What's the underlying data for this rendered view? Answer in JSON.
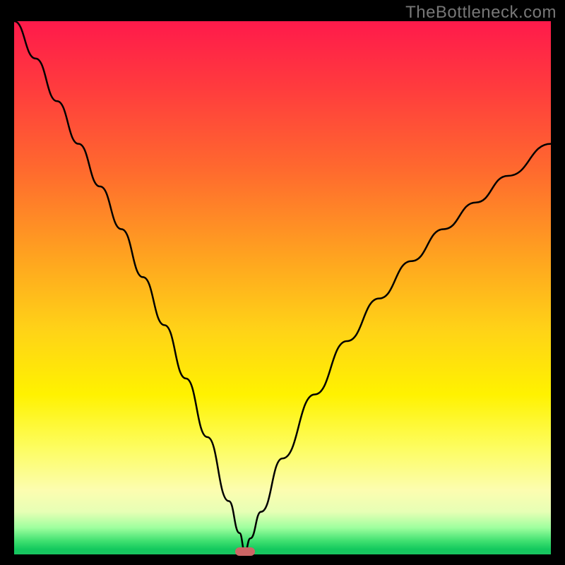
{
  "watermark": "TheBottleneck.com",
  "colors": {
    "gradient_top": "#ff1a4b",
    "gradient_bottom": "#18c560",
    "curve": "#000000",
    "marker": "#cc6666",
    "frame": "#000000"
  },
  "chart_data": {
    "type": "line",
    "title": "",
    "xlabel": "",
    "ylabel": "",
    "xlim": [
      0,
      100
    ],
    "ylim": [
      0,
      100
    ],
    "notch_x": 43,
    "marker": {
      "x": 43,
      "y": 0.5
    },
    "series": [
      {
        "name": "curve",
        "x": [
          0,
          4,
          8,
          12,
          16,
          20,
          24,
          28,
          32,
          36,
          40,
          42,
          43,
          44,
          46,
          50,
          56,
          62,
          68,
          74,
          80,
          86,
          92,
          100
        ],
        "y": [
          100,
          93,
          85,
          77,
          69,
          61,
          52,
          43,
          33,
          22,
          10,
          4,
          0.5,
          3,
          8,
          18,
          30,
          40,
          48,
          55,
          61,
          66,
          71,
          77
        ]
      }
    ]
  }
}
